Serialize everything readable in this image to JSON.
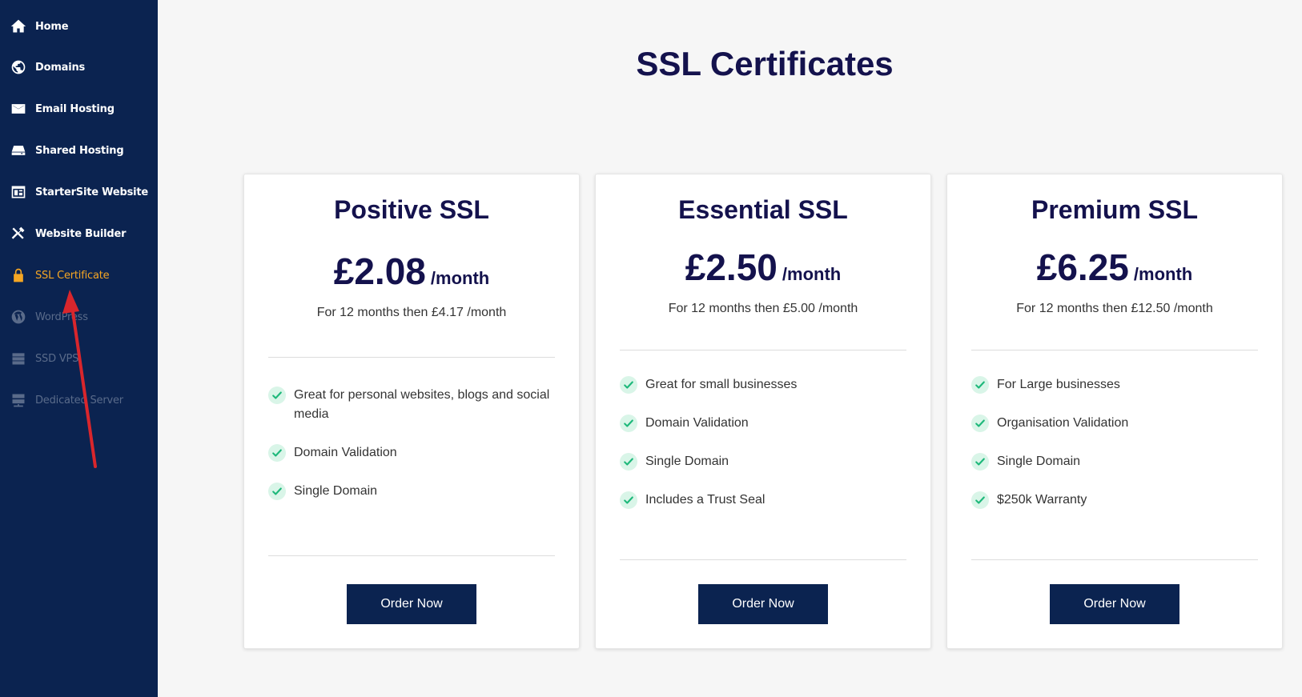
{
  "sidebar": {
    "items": [
      {
        "label": "Home",
        "icon": "home-icon",
        "state": "normal"
      },
      {
        "label": "Domains",
        "icon": "globe-icon",
        "state": "normal"
      },
      {
        "label": "Email Hosting",
        "icon": "envelope-icon",
        "state": "normal"
      },
      {
        "label": "Shared Hosting",
        "icon": "server-drive-icon",
        "state": "normal"
      },
      {
        "label": "StarterSite Website",
        "icon": "website-layout-icon",
        "state": "normal"
      },
      {
        "label": "Website Builder",
        "icon": "tools-icon",
        "state": "normal"
      },
      {
        "label": "SSL Certificate",
        "icon": "lock-icon",
        "state": "active"
      },
      {
        "label": "WordPress",
        "icon": "wordpress-icon",
        "state": "dim"
      },
      {
        "label": "SSD VPS",
        "icon": "ssd-icon",
        "state": "dim"
      },
      {
        "label": "Dedicated Server",
        "icon": "server-rack-icon",
        "state": "dim"
      }
    ]
  },
  "colors": {
    "sidebar_bg": "#0b2350",
    "active": "#f5a623",
    "heading": "#14124d",
    "button_bg": "#0b2350",
    "check_bg": "#d9f5e8",
    "check_mark": "#1db87a",
    "annotation_arrow": "#d9262c"
  },
  "page": {
    "title": "SSL Certificates"
  },
  "plans": [
    {
      "name": "Positive SSL",
      "price": "£2.08",
      "per": "/month",
      "renewal": "For 12 months then £4.17 /month",
      "features": [
        "Great for personal websites, blogs and social media",
        "Domain Validation",
        "Single Domain"
      ],
      "button": "Order Now"
    },
    {
      "name": "Essential SSL",
      "price": "£2.50",
      "per": "/month",
      "renewal": "For 12 months then £5.00 /month",
      "features": [
        "Great for small businesses",
        "Domain Validation",
        "Single Domain",
        "Includes a Trust Seal"
      ],
      "button": "Order Now"
    },
    {
      "name": "Premium SSL",
      "price": "£6.25",
      "per": "/month",
      "renewal": "For 12 months then £12.50 /month",
      "features": [
        "For Large businesses",
        "Organisation Validation",
        "Single Domain",
        "$250k Warranty"
      ],
      "button": "Order Now"
    }
  ]
}
